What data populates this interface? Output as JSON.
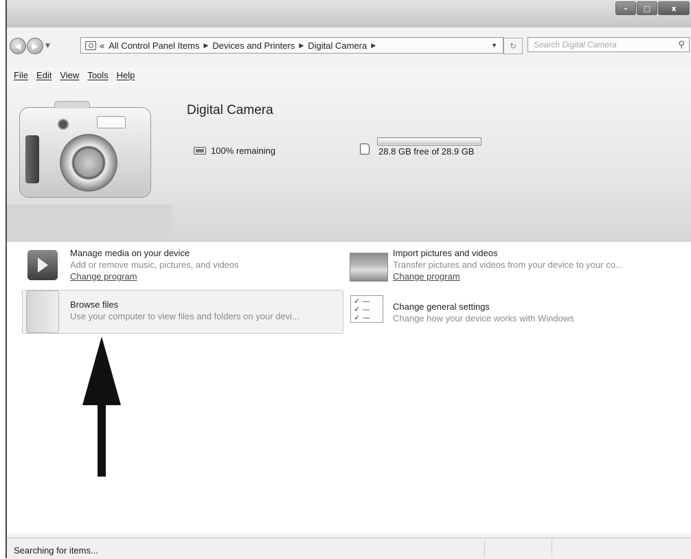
{
  "window": {
    "minimize_glyph": "–",
    "maximize_glyph": "□",
    "close_glyph": "x"
  },
  "nav": {
    "address_prefix": "«",
    "breadcrumbs": [
      "All Control Panel Items",
      "Devices and Printers",
      "Digital Camera"
    ],
    "refresh_glyph": "↻",
    "search_placeholder": "Search Digital Camera",
    "search_glyph": "⚲"
  },
  "menu": {
    "items": [
      "File",
      "Edit",
      "View",
      "Tools",
      "Help"
    ]
  },
  "device": {
    "name": "Digital Camera",
    "battery_text": "100% remaining",
    "storage_text": "28.8 GB free of 28.9 GB",
    "storage_used_fraction": 0.003
  },
  "tasks": [
    {
      "title": "Manage media on your device",
      "desc": "Add or remove music, pictures, and videos",
      "link": "Change program",
      "icon": "media-player-icon"
    },
    {
      "title": "Import pictures and videos",
      "desc": "Transfer pictures and videos from your device to your co...",
      "link": "Change program",
      "icon": "landscape-photo-icon"
    },
    {
      "title": "Browse files",
      "desc": "Use your computer to view files and folders on your devi...",
      "icon": "folder-icon"
    },
    {
      "title": "Change general settings",
      "desc": "Change how your device works with Windows",
      "icon": "checklist-icon"
    }
  ],
  "status": {
    "text": "Searching for items..."
  },
  "colors": {
    "arrow": "#111111"
  }
}
